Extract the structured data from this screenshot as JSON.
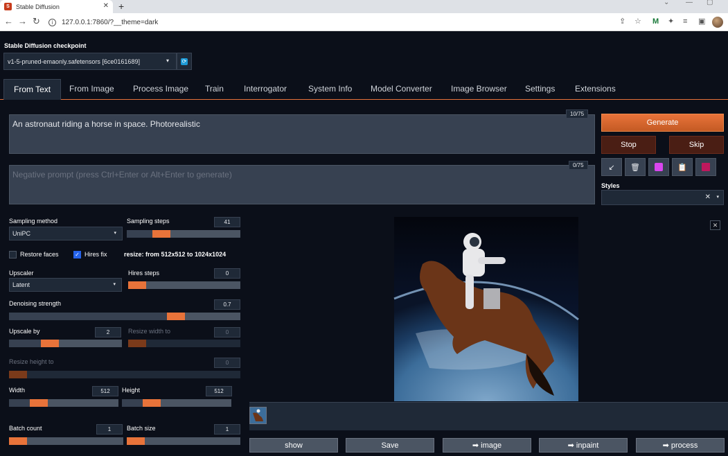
{
  "browser": {
    "tab_title": "Stable Diffusion",
    "tab_close": "✕",
    "new_tab": "+",
    "url": "127.0.0.1:7860/?__theme=dark",
    "ext_m": "M"
  },
  "checkpoint": {
    "label": "Stable Diffusion checkpoint",
    "value": "v1-5-pruned-emaonly.safetensors [6ce0161689]"
  },
  "tabs": [
    "From Text",
    "From Image",
    "Process Image",
    "Train",
    "Interrogator",
    "System Info",
    "Model Converter",
    "Image Browser",
    "Settings",
    "Extensions"
  ],
  "prompt": {
    "text": "An astronaut riding a horse in space. Photorealistic",
    "counter": "10/75",
    "negative_placeholder": "Negative prompt (press Ctrl+Enter or Alt+Enter to generate)",
    "negative_counter": "0/75"
  },
  "actions": {
    "generate": "Generate",
    "stop": "Stop",
    "skip": "Skip",
    "styles_label": "Styles"
  },
  "params": {
    "sampling_method_label": "Sampling method",
    "sampling_method": "UniPC",
    "sampling_steps_label": "Sampling steps",
    "sampling_steps": "41",
    "sampling_steps_value": 41,
    "restore_faces": "Restore faces",
    "hires_fix": "Hires fix",
    "resize_info": "resize: from 512x512 to 1024x1024",
    "upscaler_label": "Upscaler",
    "upscaler": "Latent",
    "hires_steps_label": "Hires steps",
    "hires_steps": "0",
    "denoising_label": "Denoising strength",
    "denoising": "0.7",
    "upscale_by_label": "Upscale by",
    "upscale_by": "2",
    "resize_width_label": "Resize width to",
    "resize_width": "0",
    "resize_height_label": "Resize height to",
    "resize_height": "0",
    "width_label": "Width",
    "width": "512",
    "height_label": "Height",
    "height": "512",
    "batch_count_label": "Batch count",
    "batch_count": "1",
    "batch_size_label": "Batch size",
    "batch_size": "1"
  },
  "output_buttons": [
    "show",
    "Save",
    "➡ image",
    "➡ inpaint",
    "➡ process"
  ],
  "colors": {
    "accent": "#e8733a",
    "background": "#0b0f19",
    "panel": "#1f2937"
  }
}
